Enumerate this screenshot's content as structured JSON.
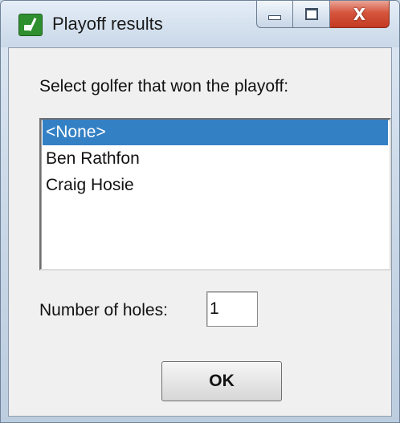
{
  "window": {
    "title": "Playoff results",
    "icon": "golf-app-icon",
    "controls": {
      "minimize_icon": "minimize-icon",
      "maximize_icon": "maximize-icon",
      "close_glyph": "X"
    }
  },
  "dialog": {
    "prompt": "Select golfer that won the playoff:",
    "golfers": [
      {
        "label": "<None>",
        "selected": true
      },
      {
        "label": "Ben Rathfon",
        "selected": false
      },
      {
        "label": "Craig Hosie",
        "selected": false
      }
    ],
    "holes_label": "Number of holes:",
    "holes_value": "1",
    "ok_label": "OK"
  },
  "colors": {
    "selection": "#3380c5",
    "close_button": "#c43a22",
    "client_background": "#f0f0f0"
  }
}
